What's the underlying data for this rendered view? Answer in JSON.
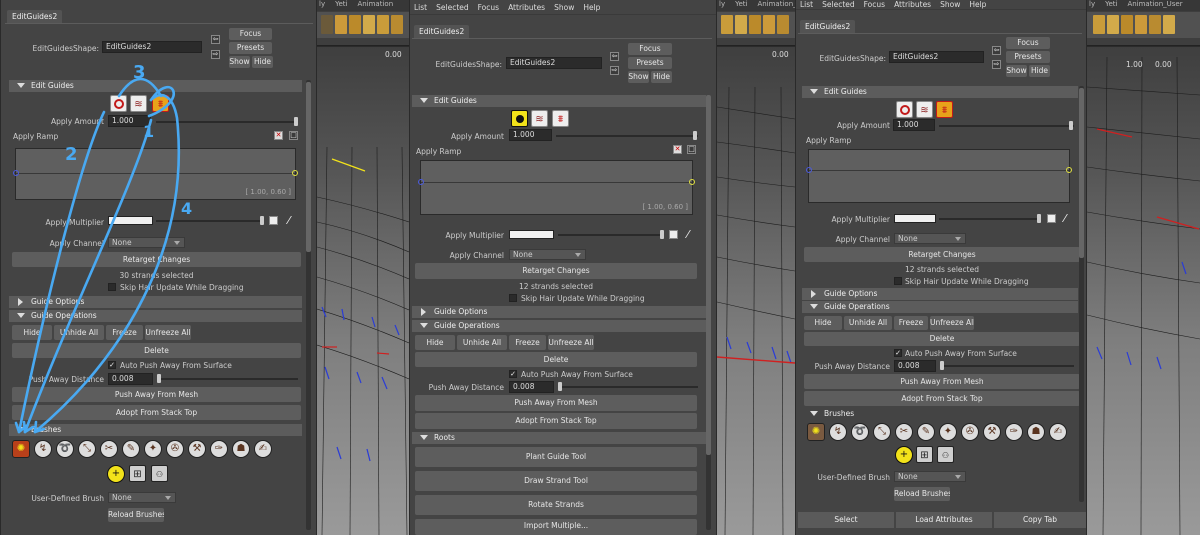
{
  "left_panel": {
    "tab": "EditGuides2",
    "shape_label": "EditGuidesShape:",
    "shape_value": "EditGuides2",
    "focus": "Focus",
    "presets": "Presets",
    "show": "Show",
    "hide": "Hide",
    "edit_guides": "Edit Guides",
    "apply_amount_label": "Apply Amount",
    "apply_amount": "1.000",
    "apply_ramp_label": "Apply Ramp",
    "ramp_value": "[ 1.00, 0.60 ]",
    "apply_multiplier_label": "Apply Multiplier",
    "apply_channel_label": "Apply Channel",
    "apply_channel": "None",
    "retarget": "Retarget Changes",
    "strands_selected": "30 strands selected",
    "skip_update": "Skip Hair Update While Dragging",
    "guide_options": "Guide Options",
    "guide_operations": "Guide Operations",
    "ops": [
      "Hide",
      "Unhide All",
      "Freeze",
      "Unfreeze All"
    ],
    "delete": "Delete",
    "auto_push": "Auto Push Away From Surface",
    "push_label": "Push Away Distance",
    "push_value": "0.008",
    "push_from_mesh": "Push Away From Mesh",
    "adopt": "Adopt From Stack Top",
    "brushes": "Brushes",
    "user_brush_label": "User-Defined Brush",
    "user_brush": "None",
    "reload": "Reload Brushes",
    "annotations": [
      "3",
      "2",
      "1",
      "4"
    ]
  },
  "mid_panel": {
    "menu": [
      "List",
      "Selected",
      "Focus",
      "Attributes",
      "Show",
      "Help"
    ],
    "tab": "EditGuides2",
    "shape_label": "EditGuidesShape:",
    "shape_value": "EditGuides2",
    "focus": "Focus",
    "presets": "Presets",
    "show": "Show",
    "hide": "Hide",
    "edit_guides": "Edit Guides",
    "apply_amount_label": "Apply Amount",
    "apply_amount": "1.000",
    "apply_ramp_label": "Apply Ramp",
    "ramp_value": "[ 1.00, 0.60 ]",
    "apply_multiplier_label": "Apply Multiplier",
    "apply_channel_label": "Apply Channel",
    "apply_channel": "None",
    "retarget": "Retarget Changes",
    "strands_selected": "12 strands selected",
    "skip_update": "Skip Hair Update While Dragging",
    "guide_options": "Guide Options",
    "guide_operations": "Guide Operations",
    "ops": [
      "Hide",
      "Unhide All",
      "Freeze",
      "Unfreeze All"
    ],
    "delete": "Delete",
    "auto_push": "Auto Push Away From Surface",
    "push_label": "Push Away Distance",
    "push_value": "0.008",
    "push_from_mesh": "Push Away From Mesh",
    "adopt": "Adopt From Stack Top",
    "roots": "Roots",
    "plant": "Plant Guide Tool",
    "draw": "Draw Strand Tool",
    "rotate": "Rotate Strands",
    "import": "Import Multiple..."
  },
  "right_panel": {
    "menu": [
      "List",
      "Selected",
      "Focus",
      "Attributes",
      "Show",
      "Help"
    ],
    "tab": "EditGuides2",
    "shape_label": "EditGuidesShape:",
    "shape_value": "EditGuides2",
    "focus": "Focus",
    "presets": "Presets",
    "show": "Show",
    "hide": "Hide",
    "edit_guides": "Edit Guides",
    "apply_amount_label": "Apply Amount",
    "apply_amount": "1.000",
    "apply_ramp_label": "Apply Ramp",
    "apply_multiplier_label": "Apply Multiplier",
    "apply_channel_label": "Apply Channel",
    "apply_channel": "None",
    "retarget": "Retarget Changes",
    "strands_selected": "12 strands selected",
    "skip_update": "Skip Hair Update While Dragging",
    "guide_options": "Guide Options",
    "guide_operations": "Guide Operations",
    "ops": [
      "Hide",
      "Unhide All",
      "Freeze",
      "Unfreeze All"
    ],
    "delete": "Delete",
    "auto_push": "Auto Push Away From Surface",
    "push_label": "Push Away Distance",
    "push_value": "0.008",
    "push_from_mesh": "Push Away From Mesh",
    "adopt": "Adopt From Stack Top",
    "brushes": "Brushes",
    "user_brush_label": "User-Defined Brush",
    "user_brush": "None",
    "reload": "Reload Brushes",
    "footer": [
      "Select",
      "Load Attributes",
      "Copy Tab"
    ]
  },
  "viewport": {
    "shelf_tabs_1": [
      "ly",
      "Yeti",
      "Animation"
    ],
    "shelf_tabs_2": [
      "ly",
      "Yeti",
      "Animation_User"
    ],
    "shelf_tabs_3": [
      "1.00",
      "0.00"
    ],
    "value_1": "0.00",
    "value_2": "0.00",
    "value_3": "1.00",
    "value_4": "0.00"
  },
  "colors": {
    "accent_yellow": "#f2e21a",
    "stroke_red": "#d02020",
    "stroke_blue": "#2a3cd6",
    "annotation_blue": "#49a9f2"
  }
}
